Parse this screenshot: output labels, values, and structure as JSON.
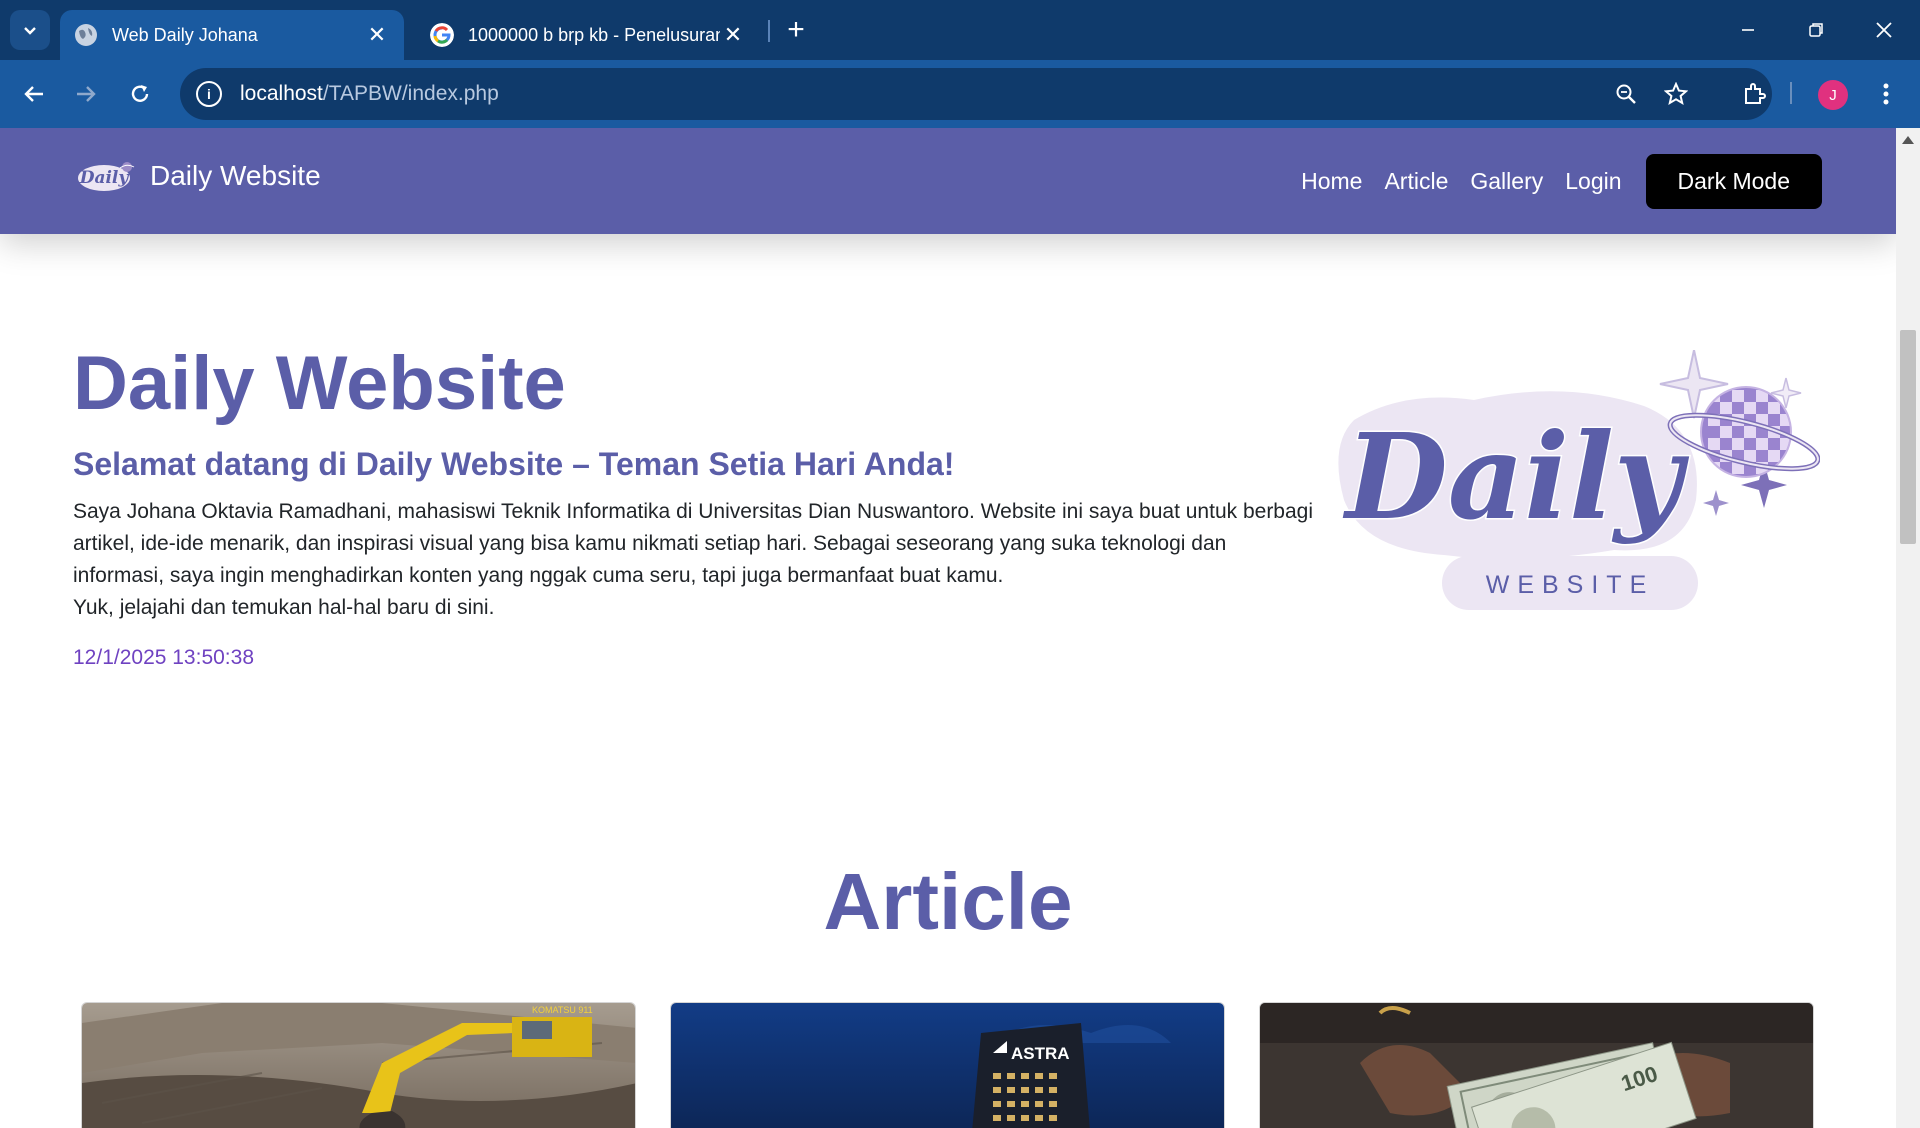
{
  "browser": {
    "tabs": [
      {
        "title": "Web Daily Johana",
        "active": true
      },
      {
        "title": "1000000 b brp kb - Penelusuran",
        "active": false
      }
    ],
    "url_host": "localhost",
    "url_path": "/TAPBW/index.php",
    "profile_initial": "J",
    "colors": {
      "frame": "#0f3a6b",
      "toolbar": "#1a5aa0",
      "avatar": "#e0317f"
    }
  },
  "site": {
    "brand": "Daily Website",
    "nav": {
      "home": "Home",
      "article": "Article",
      "gallery": "Gallery",
      "login": "Login",
      "dark_mode": "Dark Mode"
    },
    "hero": {
      "title": "Daily Website",
      "subtitle": "Selamat datang di Daily Website – Teman Setia Hari Anda!",
      "paragraph": "Saya Johana Oktavia Ramadhani, mahasiswi Teknik Informatika di Universitas Dian Nuswantoro. Website ini saya buat untuk berbagi artikel, ide-ide menarik, dan inspirasi visual yang bisa kamu nikmati setiap hari. Sebagai seseorang yang suka teknologi dan informasi, saya ingin menghadirkan konten yang nggak cuma seru, tapi juga bermanfaat buat kamu.",
      "paragraph2": "Yuk, jelajahi dan temukan hal-hal baru di sini.",
      "datetime": "12/1/2025 13:50:38",
      "logo_word": "Daily",
      "logo_tag": "WEBSITE"
    },
    "article_heading": "Article",
    "cards": [
      {
        "image": "excavator-mining-image"
      },
      {
        "image": "astra-building-night-image",
        "sign": "ASTRA"
      },
      {
        "image": "dollar-bills-hands-image"
      }
    ],
    "colors": {
      "primary": "#5b5ea8",
      "datetime": "#6f42c1",
      "dark_button": "#000000"
    }
  }
}
